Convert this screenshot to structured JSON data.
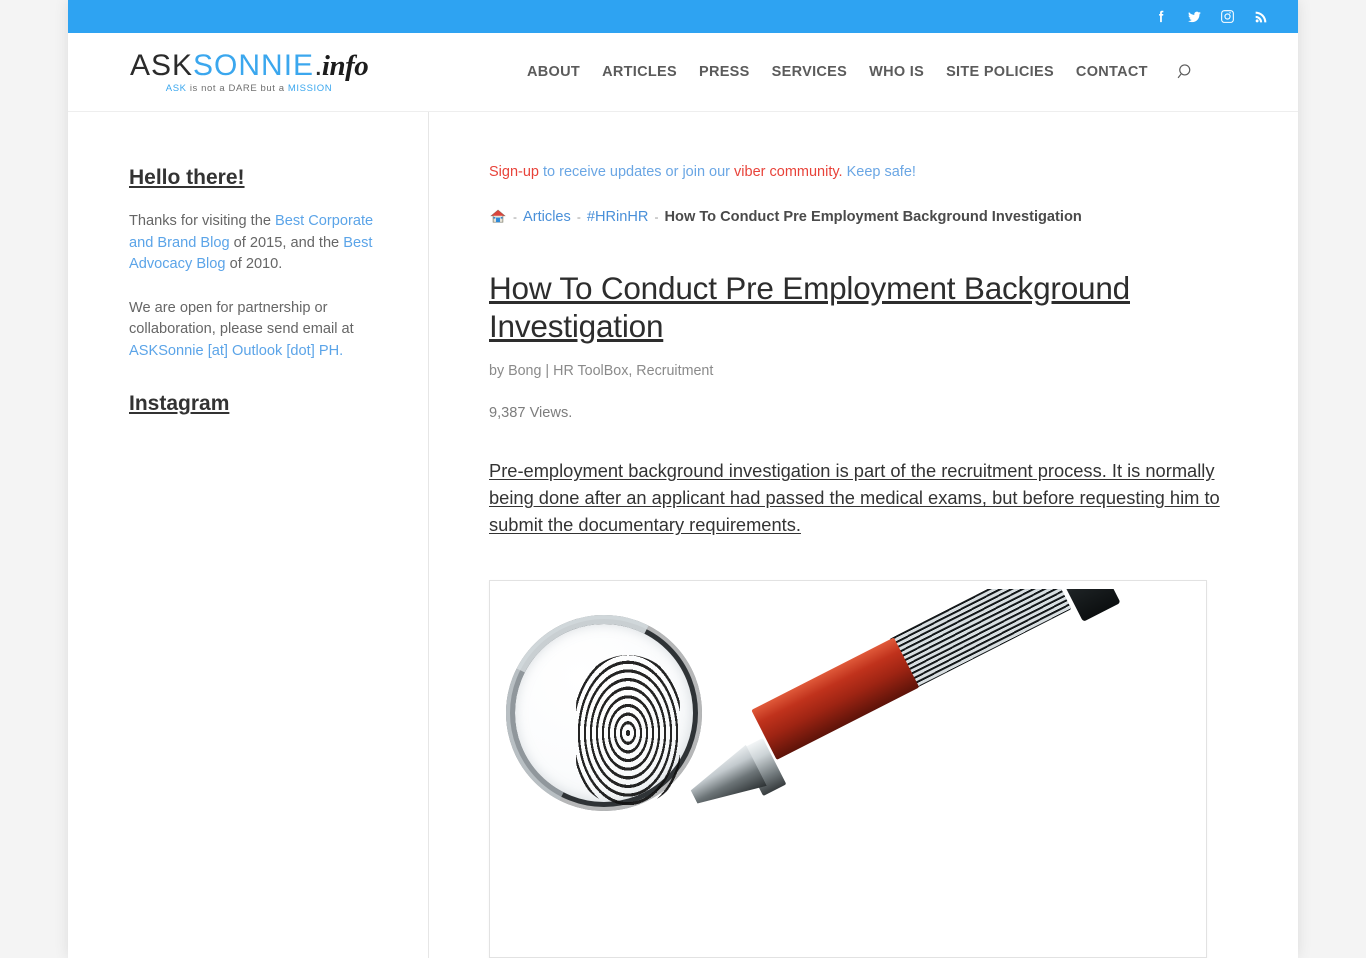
{
  "topbar": {
    "social": [
      {
        "name": "facebook-icon",
        "label": "Facebook"
      },
      {
        "name": "twitter-icon",
        "label": "Twitter"
      },
      {
        "name": "instagram-icon",
        "label": "Instagram"
      },
      {
        "name": "rss-icon",
        "label": "RSS"
      }
    ],
    "background_color": "#2ea3f2"
  },
  "logo": {
    "part_ask": "ASK",
    "part_sonnie": "SONNIE",
    "part_dot": ".",
    "part_info": "info",
    "tagline_ask": "ASK",
    "tagline_mid": " is not a DARE but a ",
    "tagline_mission": "MISSION",
    "accent_color": "#3ba7ee"
  },
  "nav": {
    "items": [
      {
        "label": "ABOUT"
      },
      {
        "label": "ARTICLES"
      },
      {
        "label": "PRESS"
      },
      {
        "label": "SERVICES"
      },
      {
        "label": "WHO IS"
      },
      {
        "label": "SITE POLICIES"
      },
      {
        "label": "CONTACT"
      }
    ],
    "search_icon": "search-icon"
  },
  "sidebar": {
    "hello_title": "Hello there!",
    "para1": {
      "t1": "Thanks for visiting the ",
      "link1": "Best Corporate and Brand Blog",
      "t2": " of 2015, and the ",
      "link2": "Best Advocacy Blog",
      "t3": " of 2010."
    },
    "para2": {
      "t1": "We are open for partnership or collaboration, please send email at ",
      "link1": "ASKSonnie [at] Outlook [dot] PH."
    },
    "instagram_title": "Instagram"
  },
  "content": {
    "notice": {
      "signup": "Sign-up",
      "mid1": " to receive updates or join our ",
      "viber": "viber community.",
      "mid2": " Keep safe!"
    },
    "breadcrumb": {
      "home_icon": "home-icon",
      "sep": "-",
      "link1": "Articles",
      "link2": "#HRinHR",
      "current": "How To Conduct Pre Employment Background Investigation"
    },
    "article": {
      "title": "How To Conduct Pre Employment Background Investigation",
      "meta": "by Bong | HR ToolBox, Recruitment",
      "views": "9,387 Views.",
      "intro": "Pre-employment background investigation is part of the recruitment process. It is normally being done after an applicant had passed the medical exams, but before requesting him to submit the documentary requirements.",
      "featured_image_alt": "magnifying-glass-over-fingerprint"
    }
  }
}
